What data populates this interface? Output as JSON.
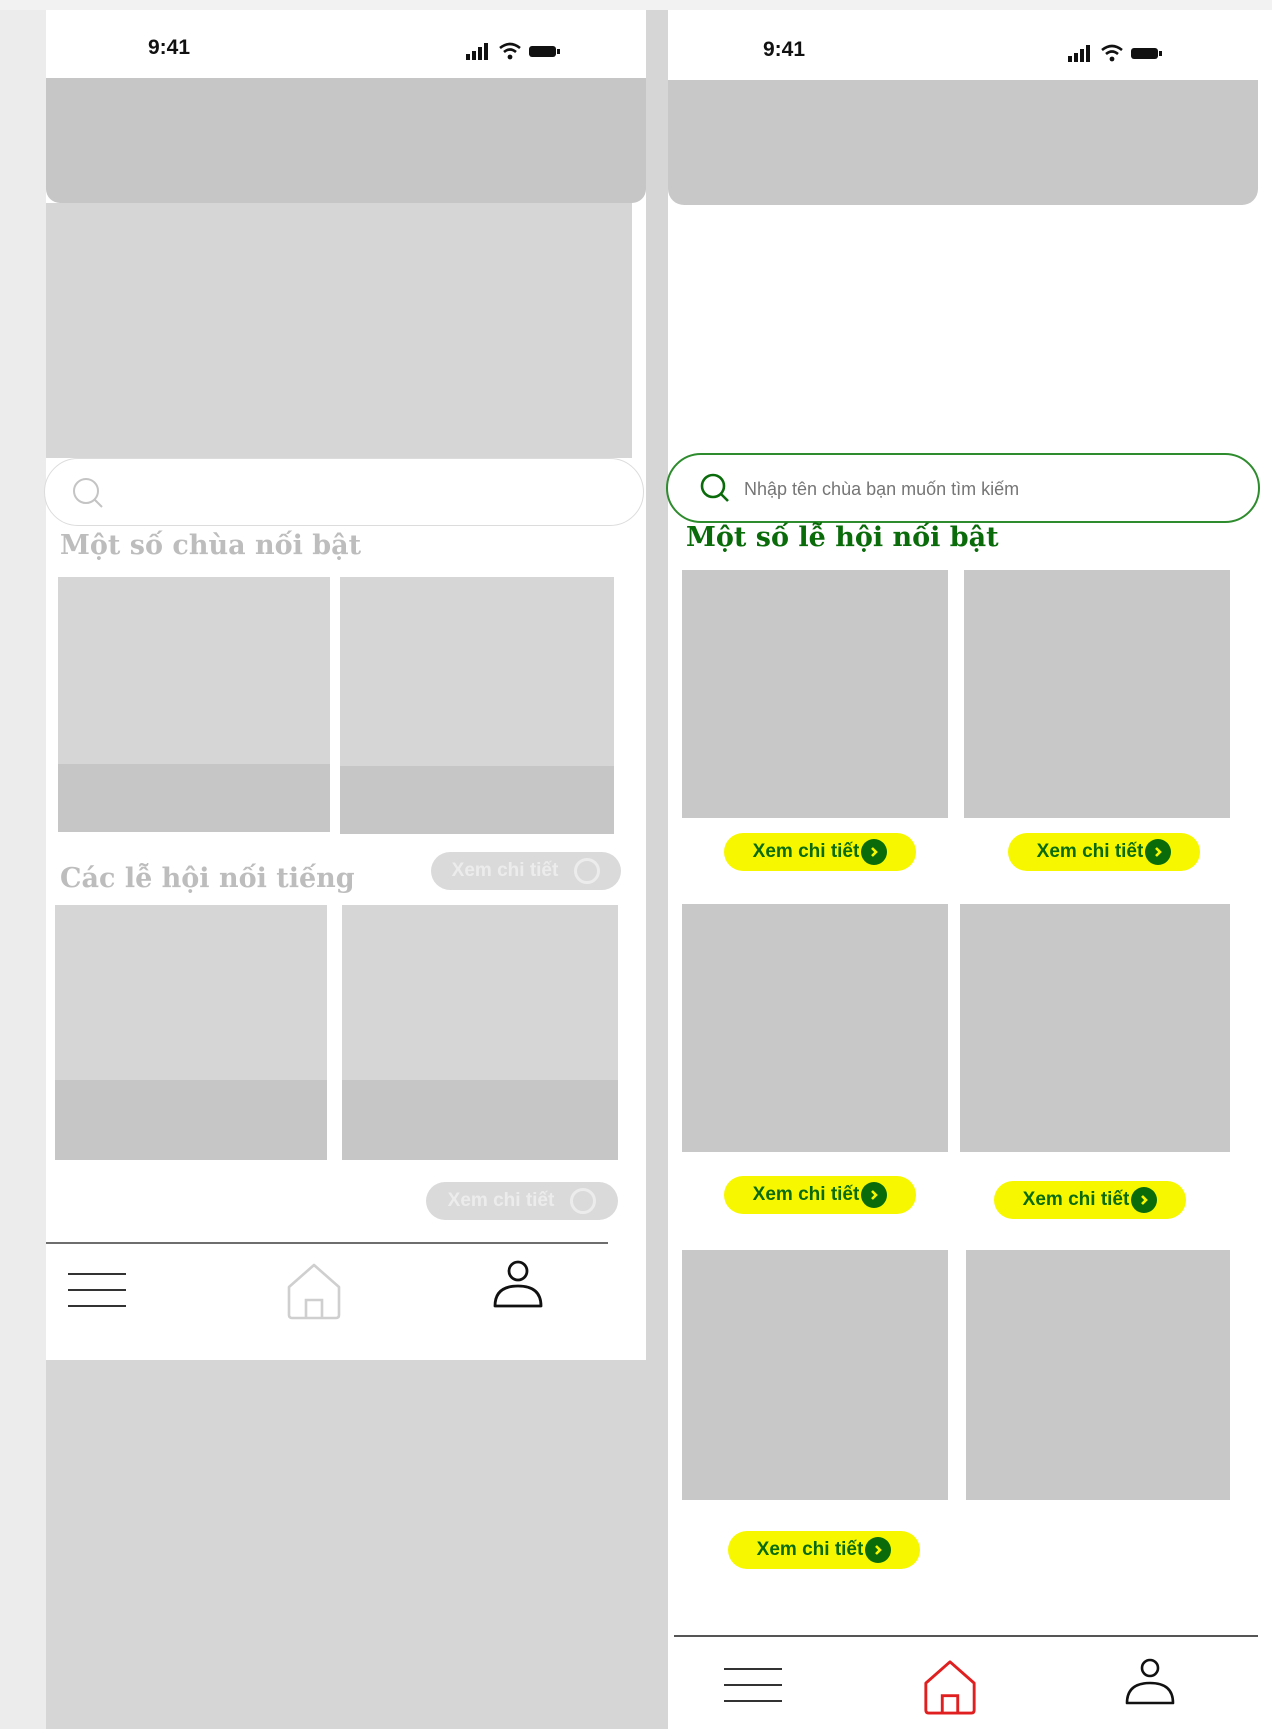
{
  "left_screen": {
    "status_time": "9:41",
    "search": {
      "placeholder": ""
    },
    "section_temples": {
      "title": "Một số chùa nối bật"
    },
    "section_festivals": {
      "title": "Các lễ hội nối tiếng",
      "view_label": "Xem chi tiết"
    },
    "bottom_view_label": "Xem chi tiết",
    "nav": {
      "menu": "menu-icon",
      "home": "home-icon",
      "profile": "user-icon"
    }
  },
  "right_screen": {
    "status_time": "9:41",
    "search": {
      "placeholder": "Nhập tên chùa bạn muốn tìm kiếm"
    },
    "section_festivals": {
      "title": "Một số lễ hội nối bật"
    },
    "cards": [
      {
        "view_label": "Xem chi tiết"
      },
      {
        "view_label": "Xem chi tiết"
      },
      {
        "view_label": "Xem chi tiết"
      },
      {
        "view_label": "Xem chi tiết"
      },
      {
        "view_label": "Xem chi tiết"
      }
    ],
    "nav": {
      "menu": "menu-icon",
      "home": "home-icon",
      "profile": "user-icon"
    }
  },
  "colors": {
    "accent_green": "#0a6b0a",
    "pill_yellow": "#f7f700",
    "home_active": "#e02020",
    "placeholder_gray": "#c8c8c8",
    "canvas_gray": "#d6d6d6"
  }
}
